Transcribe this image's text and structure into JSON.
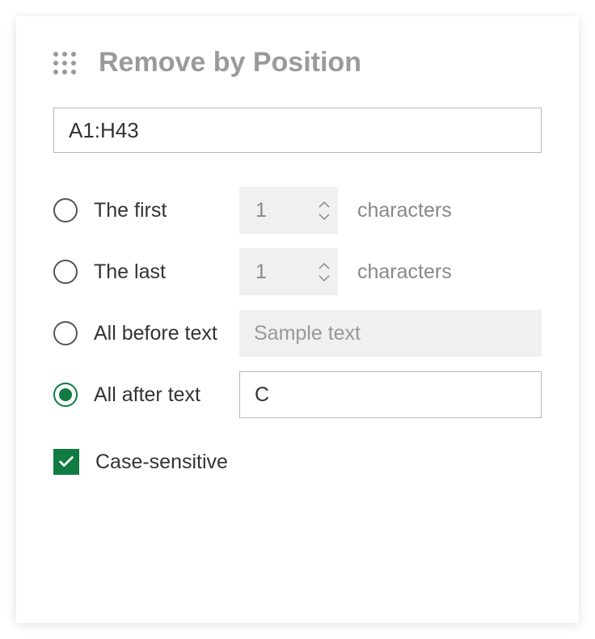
{
  "header": {
    "title": "Remove by Position"
  },
  "range": {
    "value": "A1:H43"
  },
  "options": {
    "first": {
      "label": "The first",
      "count": "1",
      "suffix": "characters",
      "selected": false
    },
    "last": {
      "label": "The last",
      "count": "1",
      "suffix": "characters",
      "selected": false
    },
    "before": {
      "label": "All before text",
      "placeholder": "Sample text",
      "value": "",
      "selected": false
    },
    "after": {
      "label": "All after text",
      "value": "C",
      "selected": true
    }
  },
  "caseSensitive": {
    "label": "Case-sensitive",
    "checked": true
  }
}
